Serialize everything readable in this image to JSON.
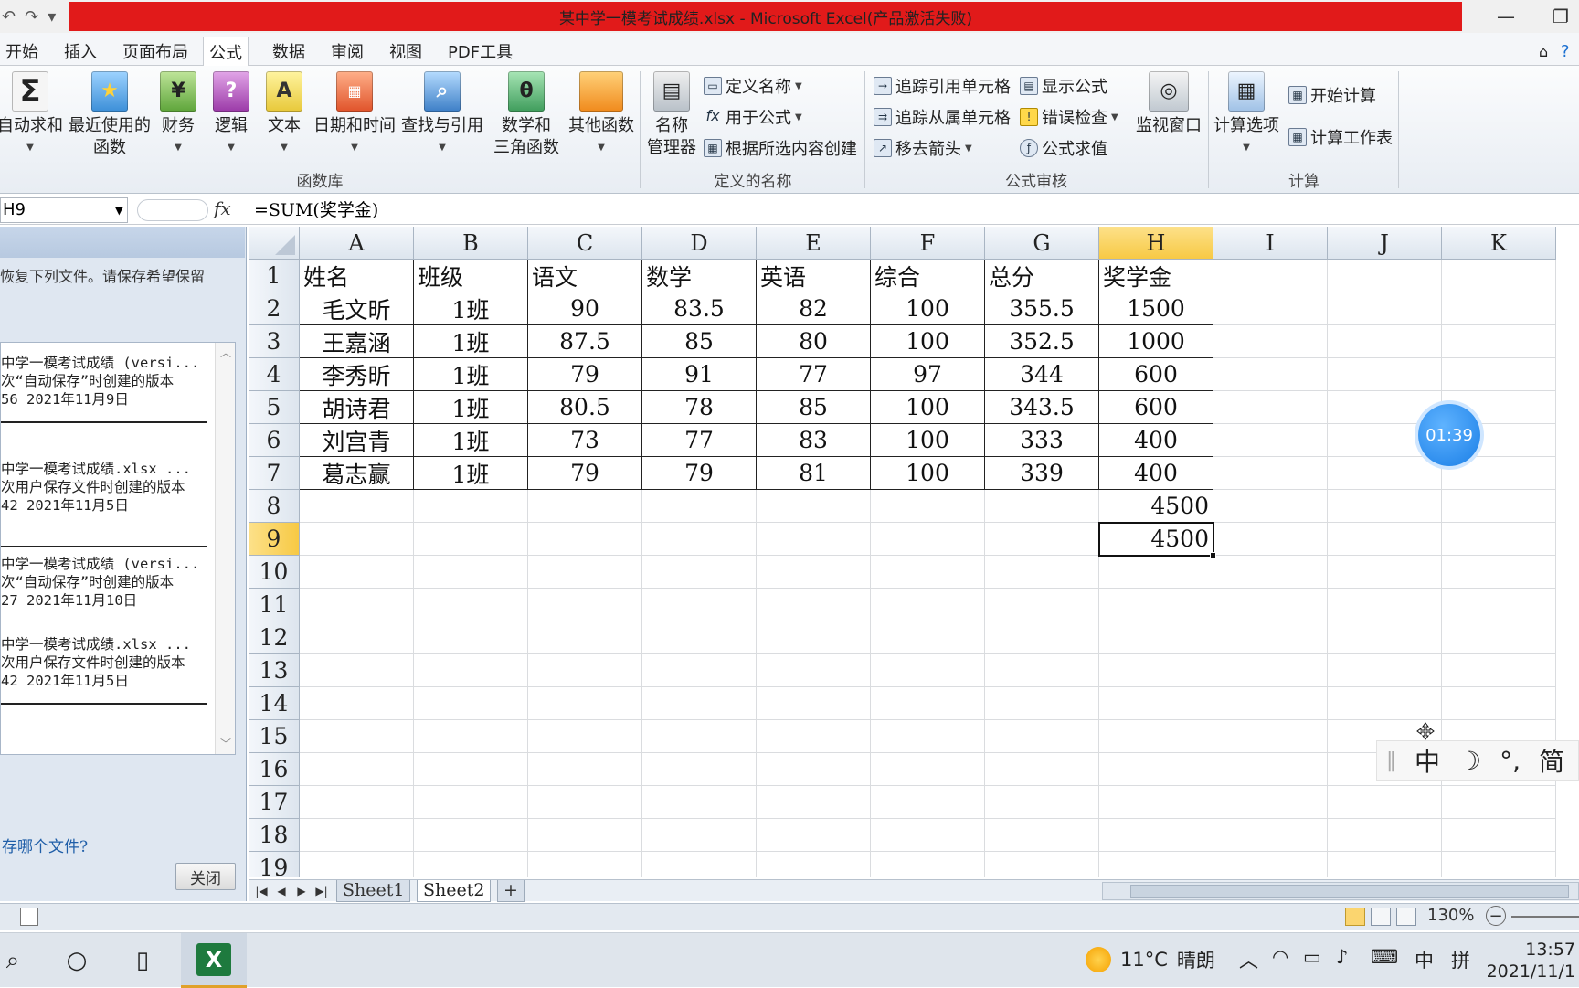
{
  "window": {
    "title": "某中学一模考试成绩.xlsx - Microsoft Excel(产品激活失败)",
    "qat": [
      "↶",
      "↷",
      "▾"
    ],
    "controls": {
      "min": "—",
      "max": "❐"
    }
  },
  "ribbon_tabs": [
    "开始",
    "插入",
    "页面布局",
    "公式",
    "数据",
    "审阅",
    "视图",
    "PDF工具"
  ],
  "active_tab": "公式",
  "ribbon": {
    "function_library": {
      "group_label": "函数库",
      "autosum": {
        "line1": "自动求和",
        "icon": "Σ"
      },
      "recent": {
        "line1": "最近使用的",
        "line2": "函数"
      },
      "financial": {
        "line1": "财务"
      },
      "logical": {
        "line1": "逻辑"
      },
      "text": {
        "line1": "文本"
      },
      "datetime": {
        "line1": "日期和时间"
      },
      "lookup": {
        "line1": "查找与引用"
      },
      "math": {
        "line1": "数学和",
        "line2": "三角函数"
      },
      "more": {
        "line1": "其他函数"
      }
    },
    "defined_names": {
      "group_label": "定义的名称",
      "name_manager": {
        "line1": "名称",
        "line2": "管理器"
      },
      "define_name": "定义名称",
      "use_in_formula": "用于公式",
      "create_from_selection": "根据所选内容创建"
    },
    "formula_auditing": {
      "group_label": "公式审核",
      "trace_precedents": "追踪引用单元格",
      "trace_dependents": "追踪从属单元格",
      "remove_arrows": "移去箭头",
      "show_formulas": "显示公式",
      "error_checking": "错误检查",
      "evaluate_formula": "公式求值",
      "watch_window": "监视窗口"
    },
    "calculation": {
      "group_label": "计算",
      "options": "计算选项",
      "calc_now": "开始计算",
      "calc_sheet": "计算工作表"
    }
  },
  "formula_bar": {
    "name_box": "H9",
    "fx": "fx",
    "formula": "=SUM(奖学金)"
  },
  "recovery_pane": {
    "message": "恢复下列文件。请保存希望保留",
    "files": [
      {
        "line1": "中学一模考试成绩 (versi...",
        "line2": "次“自动保存”时创建的版本",
        "line3": "56 2021年11月9日"
      },
      {
        "line1": "中学一模考试成绩.xlsx  ...",
        "line2": "次用户保存文件时创建的版本",
        "line3": "42 2021年11月5日"
      },
      {
        "line1": "中学一模考试成绩 (versi...",
        "line2": "次“自动保存”时创建的版本",
        "line3": "27 2021年11月10日"
      },
      {
        "line1": "中学一模考试成绩.xlsx  ...",
        "line2": "次用户保存文件时创建的版本",
        "line3": "42 2021年11月5日"
      }
    ],
    "question": "存哪个文件?",
    "close_label": "关闭"
  },
  "sheet": {
    "columns": [
      "A",
      "B",
      "C",
      "D",
      "E",
      "F",
      "G",
      "H",
      "I",
      "J",
      "K"
    ],
    "selected_column": "H",
    "selected_row": "9",
    "row_numbers": [
      "1",
      "2",
      "3",
      "4",
      "5",
      "6",
      "7",
      "8",
      "9",
      "10",
      "11",
      "12",
      "13",
      "14",
      "15",
      "16",
      "17",
      "18",
      "19"
    ],
    "header": [
      "姓名",
      "班级",
      "语文",
      "数学",
      "英语",
      "综合",
      "总分",
      "奖学金"
    ],
    "rows": [
      [
        "毛文昕",
        "1班",
        "90",
        "83.5",
        "82",
        "100",
        "355.5",
        "1500"
      ],
      [
        "王嘉涵",
        "1班",
        "87.5",
        "85",
        "80",
        "100",
        "352.5",
        "1000"
      ],
      [
        "李秀昕",
        "1班",
        "79",
        "91",
        "77",
        "97",
        "344",
        "600"
      ],
      [
        "胡诗君",
        "1班",
        "80.5",
        "78",
        "85",
        "100",
        "343.5",
        "600"
      ],
      [
        "刘宫青",
        "1班",
        "73",
        "77",
        "83",
        "100",
        "333",
        "400"
      ],
      [
        "葛志赢",
        "1班",
        "79",
        "79",
        "81",
        "100",
        "339",
        "400"
      ]
    ],
    "h8": "4500",
    "h9": "4500"
  },
  "sheet_tabs": [
    "Sheet1",
    "Sheet2"
  ],
  "active_sheet": "Sheet2",
  "status": {
    "zoom": "130%"
  },
  "taskbar": {
    "weather_temp": "11°C",
    "weather_desc": "晴朗",
    "ime_lang": "中",
    "ime_mode": "拼",
    "time": "13:57",
    "date": "2021/11/1"
  },
  "overlays": {
    "timer": "01:39",
    "ime_bar": [
      "中",
      "☽",
      "°,",
      "简"
    ]
  },
  "colors": {
    "title_red": "#e11a1a",
    "selected_header": "#f7c944",
    "excel_green": "#1e7a3e",
    "timer_blue": "#1a7ee6"
  }
}
